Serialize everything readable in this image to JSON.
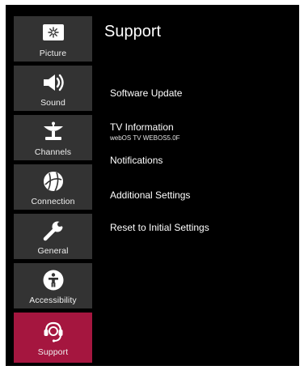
{
  "sidebar": {
    "items": [
      {
        "label": "Picture",
        "icon": "picture-icon",
        "active": false
      },
      {
        "label": "Sound",
        "icon": "speaker-icon",
        "active": false
      },
      {
        "label": "Channels",
        "icon": "satellite-dish-icon",
        "active": false
      },
      {
        "label": "Connection",
        "icon": "globe-icon",
        "active": false
      },
      {
        "label": "General",
        "icon": "wrench-icon",
        "active": false
      },
      {
        "label": "Accessibility",
        "icon": "accessibility-icon",
        "active": false
      },
      {
        "label": "Support",
        "icon": "headset-icon",
        "active": true
      }
    ]
  },
  "main": {
    "title": "Support",
    "menu": [
      {
        "label": "Software Update"
      },
      {
        "label": "TV Information",
        "sub": "webOS TV WEBOS5.0F"
      },
      {
        "label": "Notifications"
      },
      {
        "label": "Additional Settings"
      },
      {
        "label": "Reset to Initial Settings"
      }
    ]
  },
  "colors": {
    "background": "#000000",
    "sidebar_item": "#333333",
    "active_item": "#a5163f",
    "text": "#ffffff"
  }
}
